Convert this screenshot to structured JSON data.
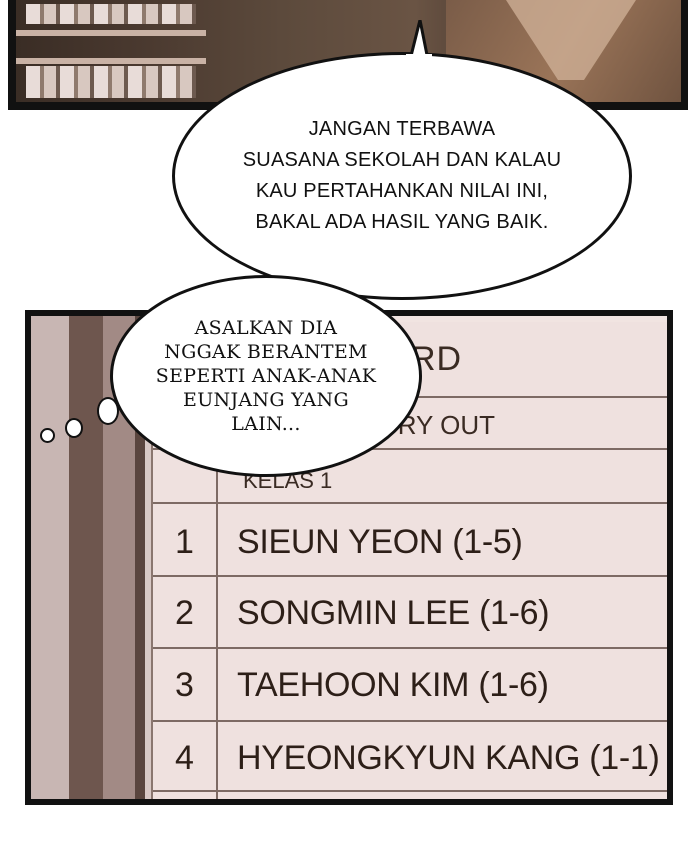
{
  "bubbles": {
    "top": "JANGAN TERBAWA\nSUASANA SEKOLAH DAN KALAU\nKAU PERTAHANKAN NILAI INI,\nBAKAL ADA HASIL YANG BAIK.",
    "left": "ASALKAN DIA\nNGGAK BERANTEM\nSEPERTI ANAK-ANAK\nEUNJANG YANG\nLAIN..."
  },
  "board": {
    "title": "OARD",
    "subtitle": "KAT TRY OUT",
    "class_label": "KELAS 1",
    "rows": [
      {
        "num": "1",
        "name": "SIEUN YEON (1-5)"
      },
      {
        "num": "2",
        "name": "SONGMIN LEE (1-6)"
      },
      {
        "num": "3",
        "name": "TAEHOON KIM (1-6)"
      },
      {
        "num": "4",
        "name": "HYEONGKYUN KANG (1-1)"
      }
    ]
  }
}
